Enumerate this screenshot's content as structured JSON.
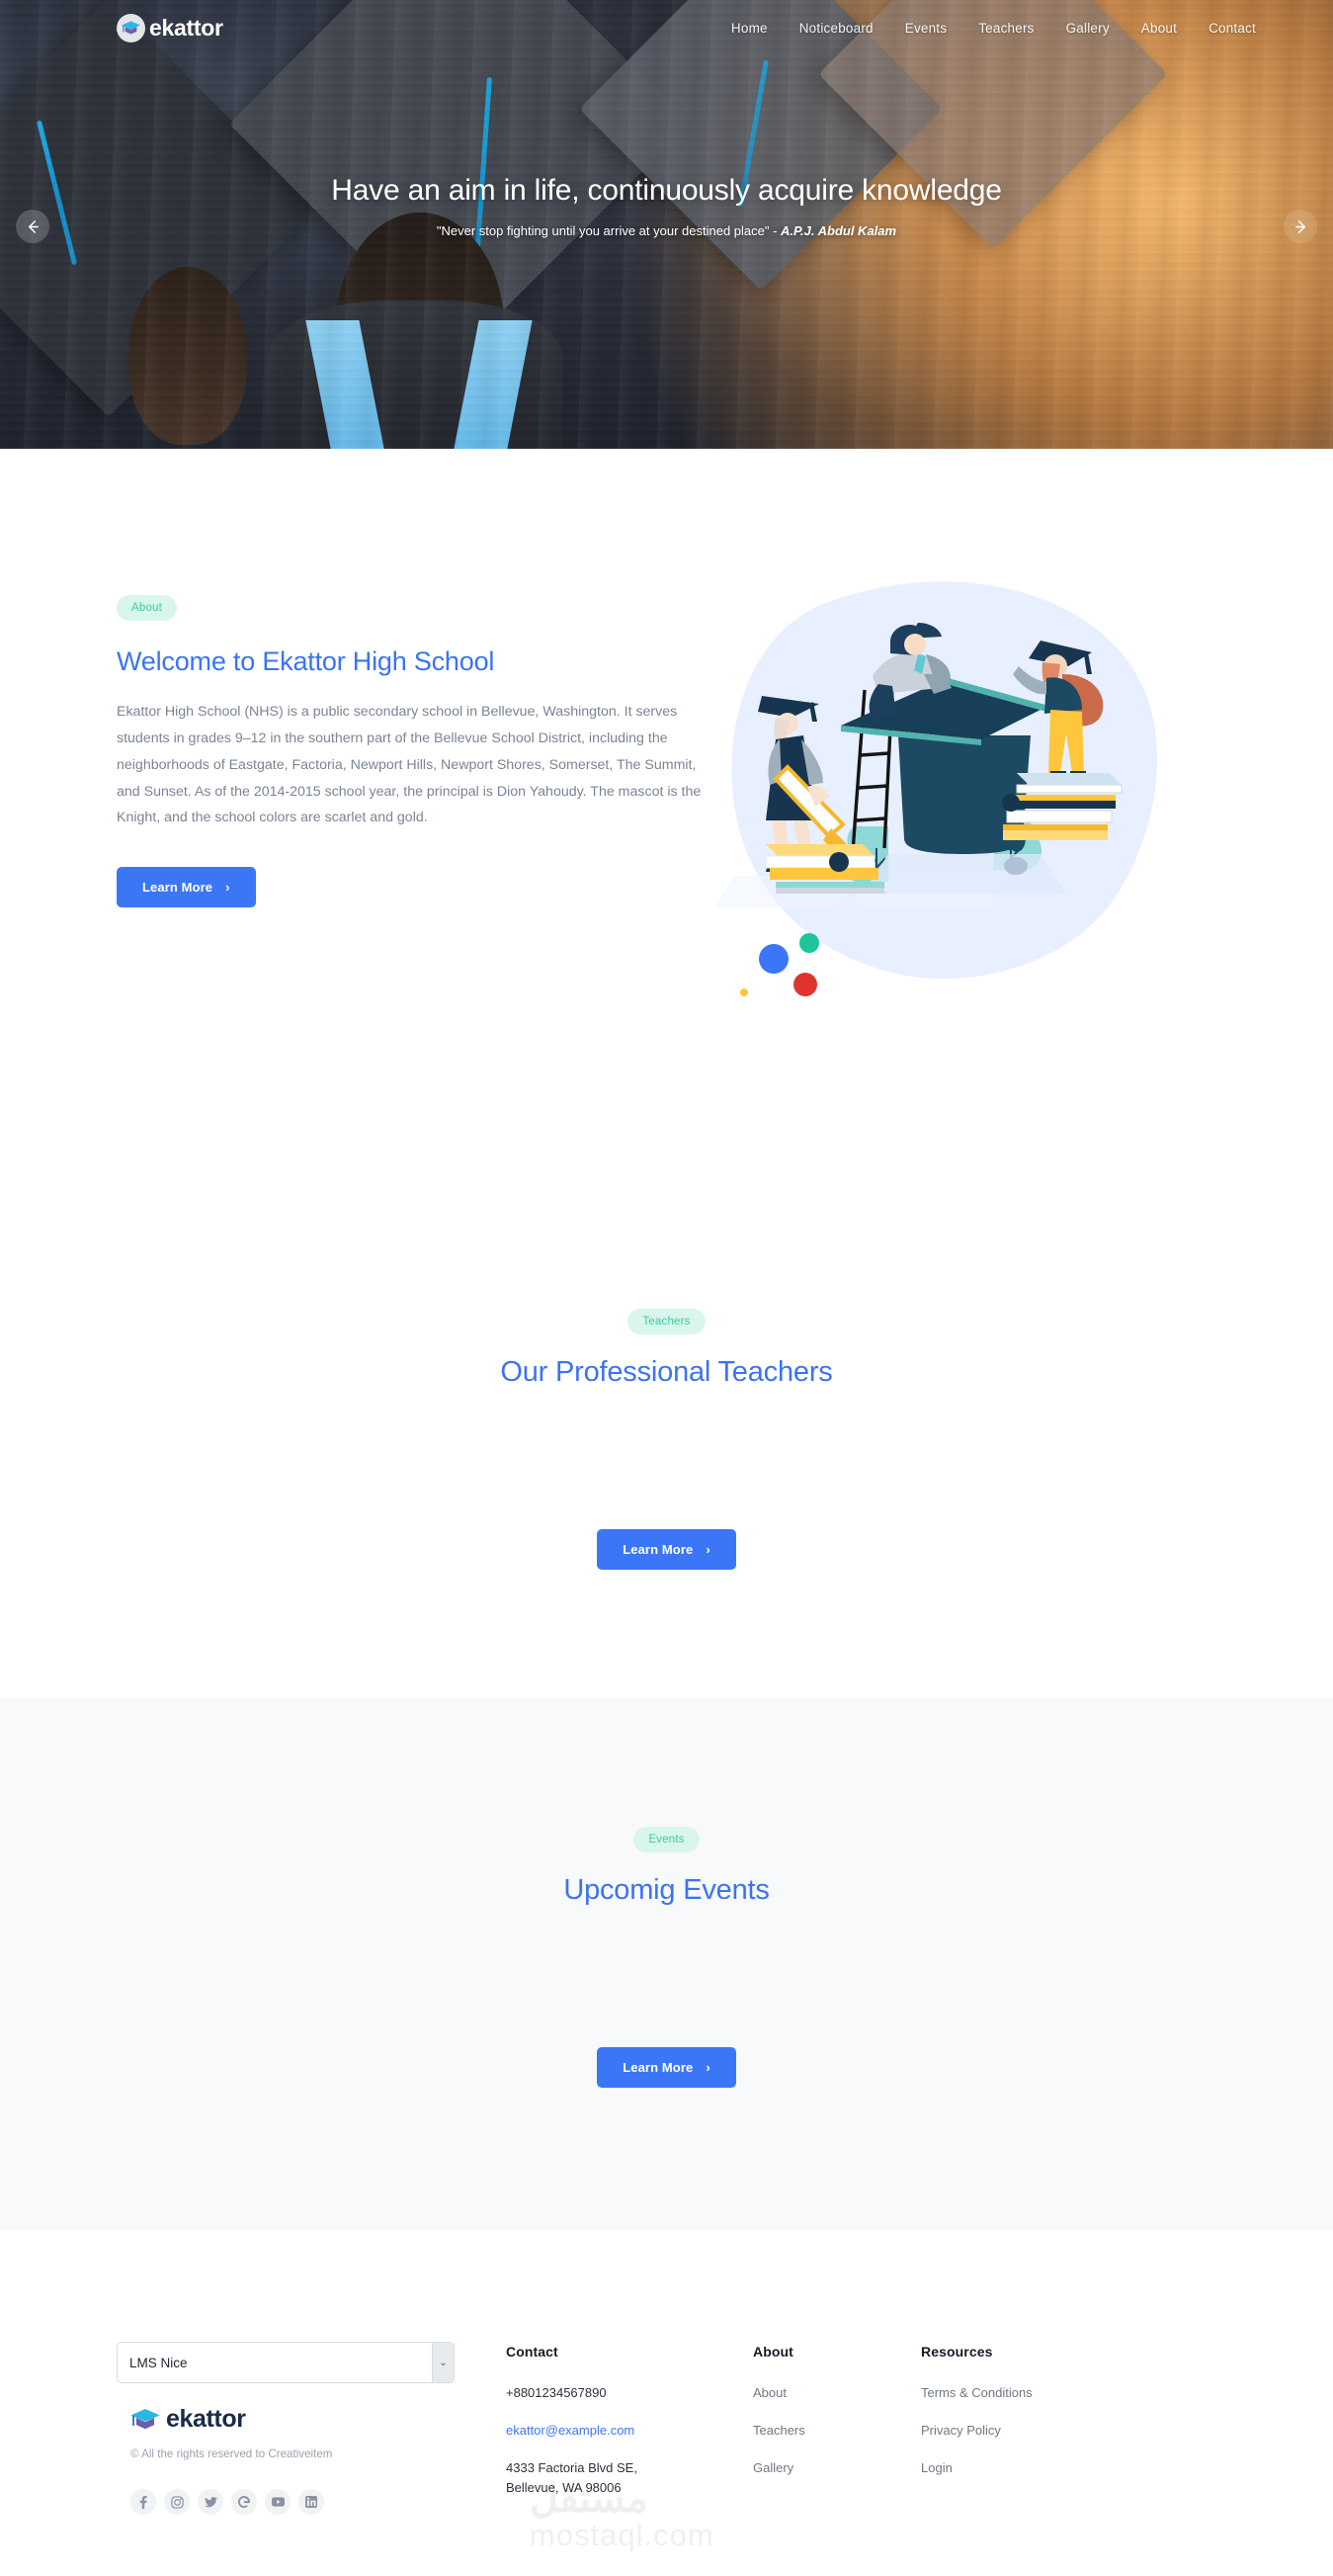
{
  "brand": {
    "name": "ekattor",
    "icon": "graduation-cap-icon"
  },
  "nav": {
    "items": [
      {
        "label": "Home"
      },
      {
        "label": "Noticeboard"
      },
      {
        "label": "Events"
      },
      {
        "label": "Teachers"
      },
      {
        "label": "Gallery"
      },
      {
        "label": "About"
      },
      {
        "label": "Contact"
      }
    ]
  },
  "hero": {
    "title": "Have an aim in life, continuously acquire knowledge",
    "quote": "\"Never stop fighting until you arrive at your destined place\" - ",
    "author": "A.P.J. Abdul Kalam",
    "prev_icon": "arrow-left-icon",
    "next_icon": "arrow-right-icon"
  },
  "about": {
    "pill": "About",
    "title": "Welcome to Ekattor High School",
    "body": "Ekattor High School (NHS) is a public secondary school in Bellevue, Washington. It serves students in grades 9–12 in the southern part of the Bellevue School District, including the neighborhoods of Eastgate, Factoria, Newport Hills, Newport Shores, Somerset, The Summit, and Sunset. As of the 2014-2015 school year, the principal is Dion Yahoudy. The mascot is the Knight, and the school colors are scarlet and gold.",
    "button": "Learn More",
    "button_chevron": "›"
  },
  "teachers": {
    "pill": "Teachers",
    "title": "Our Professional Teachers",
    "button": "Learn More",
    "button_chevron": "›"
  },
  "events": {
    "pill": "Events",
    "title": "Upcomig Events",
    "button": "Learn More",
    "button_chevron": "›"
  },
  "footer": {
    "language_select": {
      "value": "LMS Nice",
      "caret": "⌄"
    },
    "logo_text": "ekattor",
    "copyright": "© All the rights reserved to Creativeitem",
    "socials": [
      {
        "name": "facebook-icon",
        "glyph": "f"
      },
      {
        "name": "instagram-icon",
        "glyph": "◻"
      },
      {
        "name": "twitter-icon",
        "glyph": "🐦"
      },
      {
        "name": "google-icon",
        "glyph": "G"
      },
      {
        "name": "youtube-icon",
        "glyph": "▶"
      },
      {
        "name": "linkedin-icon",
        "glyph": "in"
      }
    ],
    "contact": {
      "heading": "Contact",
      "phone": "+8801234567890",
      "email": "ekattor@example.com",
      "address_line1": "4333 Factoria Blvd SE,",
      "address_line2": "Bellevue, WA 98006"
    },
    "about": {
      "heading": "About",
      "items": [
        {
          "label": "About"
        },
        {
          "label": "Teachers"
        },
        {
          "label": "Gallery"
        }
      ]
    },
    "resources": {
      "heading": "Resources",
      "items": [
        {
          "label": "Terms & Conditions"
        },
        {
          "label": "Privacy Policy"
        },
        {
          "label": "Login"
        }
      ]
    },
    "watermark_arabic": "مستقل",
    "watermark_latin": "mostaql.com"
  },
  "colors": {
    "primary_blue": "#3b76f6",
    "heading_blue": "#3b73f5",
    "pill_bg": "#d9f6ec",
    "pill_text": "#3bc9a4",
    "section_bg": "#f7f9fb",
    "body_text": "#7b8494"
  }
}
